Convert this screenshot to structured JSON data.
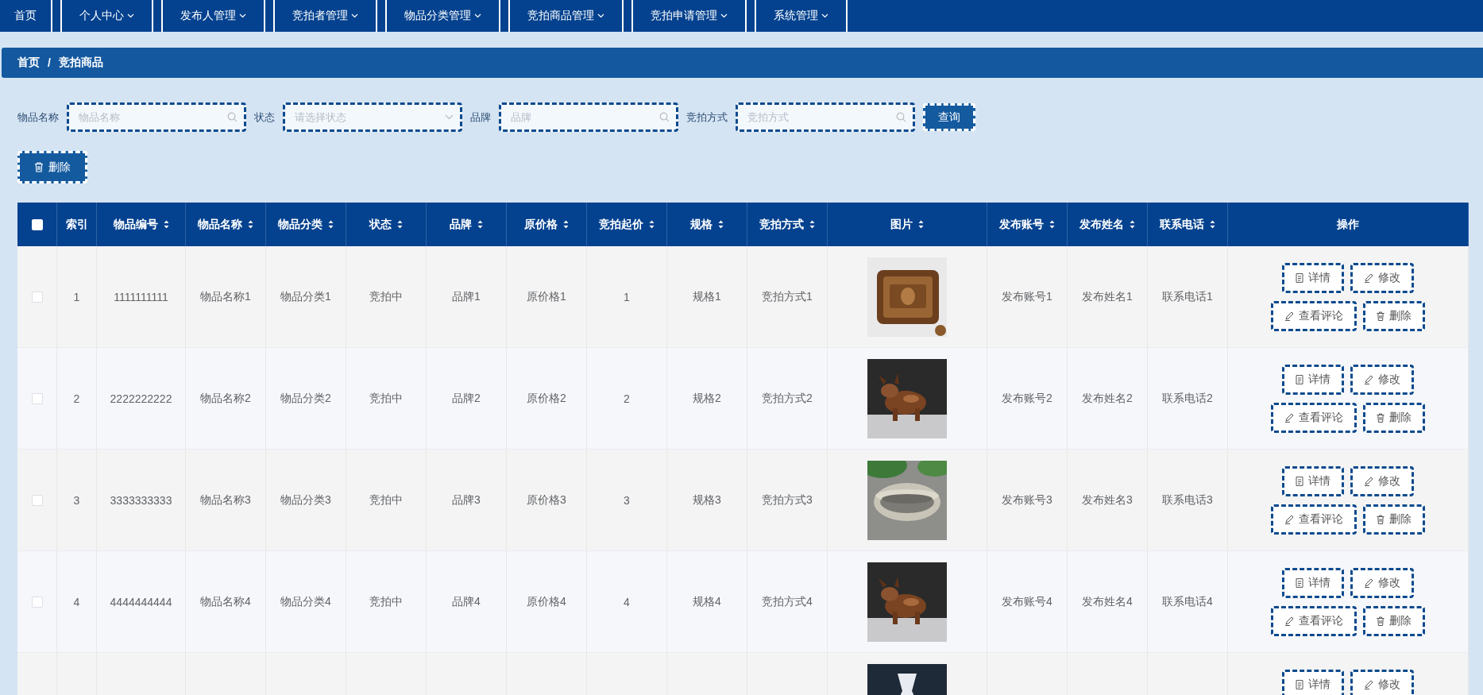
{
  "nav": [
    {
      "label": "首页",
      "has_menu": false
    },
    {
      "label": "个人中心",
      "has_menu": true
    },
    {
      "label": "发布人管理",
      "has_menu": true
    },
    {
      "label": "竞拍者管理",
      "has_menu": true
    },
    {
      "label": "物品分类管理",
      "has_menu": true
    },
    {
      "label": "竞拍商品管理",
      "has_menu": true
    },
    {
      "label": "竞拍申请管理",
      "has_menu": true
    },
    {
      "label": "系统管理",
      "has_menu": true
    }
  ],
  "breadcrumb": {
    "items": [
      "首页",
      "竞拍商品"
    ],
    "separator": "/"
  },
  "filters": [
    {
      "label": "物品名称",
      "placeholder": "物品名称",
      "kind": "search"
    },
    {
      "label": "状态",
      "placeholder": "请选择状态",
      "kind": "select"
    },
    {
      "label": "品牌",
      "placeholder": "品牌",
      "kind": "search"
    },
    {
      "label": "竞拍方式",
      "placeholder": "竞拍方式",
      "kind": "search"
    }
  ],
  "query_button": "查询",
  "delete_button": "删除",
  "table": {
    "select_all_checked": false,
    "columns": [
      {
        "label": "索引",
        "sortable": false
      },
      {
        "label": "物品编号",
        "sortable": true
      },
      {
        "label": "物品名称",
        "sortable": true
      },
      {
        "label": "物品分类",
        "sortable": true
      },
      {
        "label": "状态",
        "sortable": true
      },
      {
        "label": "品牌",
        "sortable": true
      },
      {
        "label": "原价格",
        "sortable": true
      },
      {
        "label": "竞拍起价",
        "sortable": true
      },
      {
        "label": "规格",
        "sortable": true
      },
      {
        "label": "竞拍方式",
        "sortable": true
      },
      {
        "label": "图片",
        "sortable": true
      },
      {
        "label": "发布账号",
        "sortable": true
      },
      {
        "label": "发布姓名",
        "sortable": true
      },
      {
        "label": "联系电话",
        "sortable": true
      },
      {
        "label": "操作",
        "sortable": false
      }
    ],
    "rows": [
      {
        "checked": false,
        "cells": [
          "1",
          "1111111111",
          "物品名称1",
          "物品分类1",
          "竞拍中",
          "品牌1",
          "原价格1",
          "1",
          "规格1",
          "竞拍方式1",
          {
            "kind": "picture"
          },
          "发布账号1",
          "发布姓名1",
          "联系电话1"
        ],
        "actions": [
          {
            "label": "详情",
            "kind": "detail"
          },
          {
            "label": "修改",
            "kind": "edit"
          },
          {
            "label": "查看评论",
            "kind": "comment"
          },
          {
            "label": "删除",
            "kind": "delete"
          }
        ]
      },
      {
        "checked": false,
        "cells": [
          "2",
          "2222222222",
          "物品名称2",
          "物品分类2",
          "竞拍中",
          "品牌2",
          "原价格2",
          "2",
          "规格2",
          "竞拍方式2",
          {
            "kind": "picture"
          },
          "发布账号2",
          "发布姓名2",
          "联系电话2"
        ],
        "actions": [
          {
            "label": "详情",
            "kind": "detail"
          },
          {
            "label": "修改",
            "kind": "edit"
          },
          {
            "label": "查看评论",
            "kind": "comment"
          },
          {
            "label": "删除",
            "kind": "delete"
          }
        ]
      },
      {
        "checked": false,
        "cells": [
          "3",
          "3333333333",
          "物品名称3",
          "物品分类3",
          "竞拍中",
          "品牌3",
          "原价格3",
          "3",
          "规格3",
          "竞拍方式3",
          {
            "kind": "picture"
          },
          "发布账号3",
          "发布姓名3",
          "联系电话3"
        ],
        "actions": [
          {
            "label": "详情",
            "kind": "detail"
          },
          {
            "label": "修改",
            "kind": "edit"
          },
          {
            "label": "查看评论",
            "kind": "comment"
          },
          {
            "label": "删除",
            "kind": "delete"
          }
        ]
      },
      {
        "checked": false,
        "cells": [
          "4",
          "4444444444",
          "物品名称4",
          "物品分类4",
          "竞拍中",
          "品牌4",
          "原价格4",
          "4",
          "规格4",
          "竞拍方式4",
          {
            "kind": "picture"
          },
          "发布账号4",
          "发布姓名4",
          "联系电话4"
        ],
        "actions": [
          {
            "label": "详情",
            "kind": "detail"
          },
          {
            "label": "修改",
            "kind": "edit"
          },
          {
            "label": "查看评论",
            "kind": "comment"
          },
          {
            "label": "删除",
            "kind": "delete"
          }
        ]
      },
      {
        "cells": [
          null,
          null,
          null,
          null,
          null,
          null,
          null,
          null,
          null,
          null,
          {
            "kind": "picture"
          }
        ],
        "actions": [
          {
            "label": "详情",
            "kind": "detail"
          },
          {
            "label": "修改",
            "kind": "edit"
          }
        ]
      }
    ]
  }
}
